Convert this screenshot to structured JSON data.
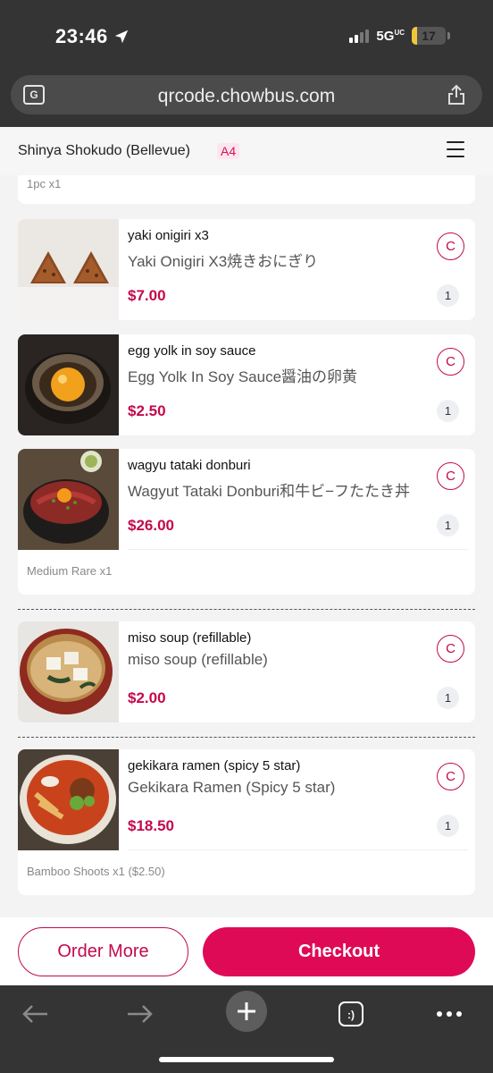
{
  "status_bar": {
    "time": "23:46",
    "network": "5G",
    "network_suffix": "UC",
    "battery_percent": "17",
    "battery_level": 0.17
  },
  "browser": {
    "url": "qrcode.chowbus.com",
    "icons": [
      "translate-icon",
      "share-icon",
      "back-icon",
      "forward-icon",
      "new-tab-icon",
      "tabs-icon",
      "more-icon"
    ]
  },
  "header": {
    "restaurant": "Shinya Shokudo (Bellevue)",
    "table": "A4"
  },
  "list": {
    "top_note": "1pc x1",
    "items": [
      {
        "name": "yaki onigiri x3",
        "subtitle": "Yaki Onigiri X3焼きおにぎり",
        "price": "$7.00",
        "qty": "1",
        "c_label": "C",
        "note": ""
      },
      {
        "name": "egg yolk in soy sauce",
        "subtitle": "Egg Yolk In Soy Sauce醤油の卵黄",
        "price": "$2.50",
        "qty": "1",
        "c_label": "C",
        "note": ""
      },
      {
        "name": "wagyu tataki donburi",
        "subtitle": "Wagyut Tataki Donburi和牛ビ−フたたき丼",
        "price": "$26.00",
        "qty": "1",
        "c_label": "C",
        "note": "Medium Rare x1"
      },
      {
        "name": "miso soup (refillable)",
        "subtitle": "miso soup (refillable)",
        "price": "$2.00",
        "qty": "1",
        "c_label": "C",
        "note": ""
      },
      {
        "name": "gekikara ramen (spicy 5 star)",
        "subtitle": "Gekikara Ramen (Spicy 5 star)",
        "price": "$18.50",
        "qty": "1",
        "c_label": "C",
        "note": "Bamboo Shoots x1 ($2.50)"
      }
    ]
  },
  "actions": {
    "order_more": "Order More",
    "checkout": "Checkout"
  },
  "colors": {
    "accent": "#c3094c",
    "checkout_bg": "#df0a55",
    "chrome": "#343434"
  }
}
